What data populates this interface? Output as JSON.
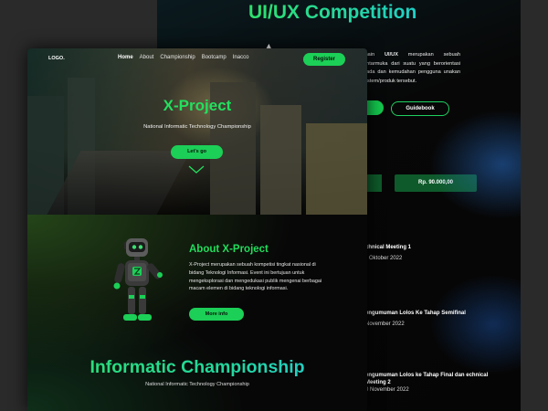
{
  "background_mockup": {
    "title": "UI/UX Competition",
    "paragraph_parts": {
      "p1": "main ",
      "p2": "UI/UX",
      "p3": " merupakan sebuah antarmuka dari suatu yang berorientasi pada dan kemudahan pengguna unakan sistem/produk tersebut."
    },
    "guidebook_label": "Guidebook",
    "price_label": "Rp. 90.000,00",
    "timeline": [
      {
        "title": "chnical Meeting 1",
        "date": "Oktober 2022"
      },
      {
        "title": "engumuman Lolos Ke Tahap Semifinal",
        "date": "November 2022"
      },
      {
        "title": "engumuman Lolos ke Tahap Final dan echnical Meeting 2",
        "date": "0 November 2022"
      }
    ]
  },
  "foreground_mockup": {
    "logo": "LOGO.",
    "nav_items": [
      "Home",
      "About",
      "Championship",
      "Bootcamp",
      "Inacco"
    ],
    "register_label": "Register",
    "hero": {
      "title": "X-Project",
      "subtitle": "National Informatic Technology Championship",
      "cta_label": "Let's go"
    },
    "about": {
      "title": "About X-Project",
      "text": "X-Project merupakan sebuah kompetisi tingkat nasional di bidang Teknologi Informasi. Event ini bertujuan untuk mengeksplorasi dan mengedukasi publik mengenai berbagai macam elemen di bidang teknologi informasi.",
      "more_info_label": "More info"
    },
    "championship": {
      "title": "Informatic Championship",
      "subtitle": "National Informatic Technology Championship"
    }
  },
  "colors": {
    "accent_green": "#1ccf57",
    "title_green": "#22e05e",
    "gradient_cyan": "#24c8e0",
    "background": "#060606"
  },
  "icons": [
    "cursor-icon",
    "chevron-down-icon",
    "robot-illustration"
  ]
}
